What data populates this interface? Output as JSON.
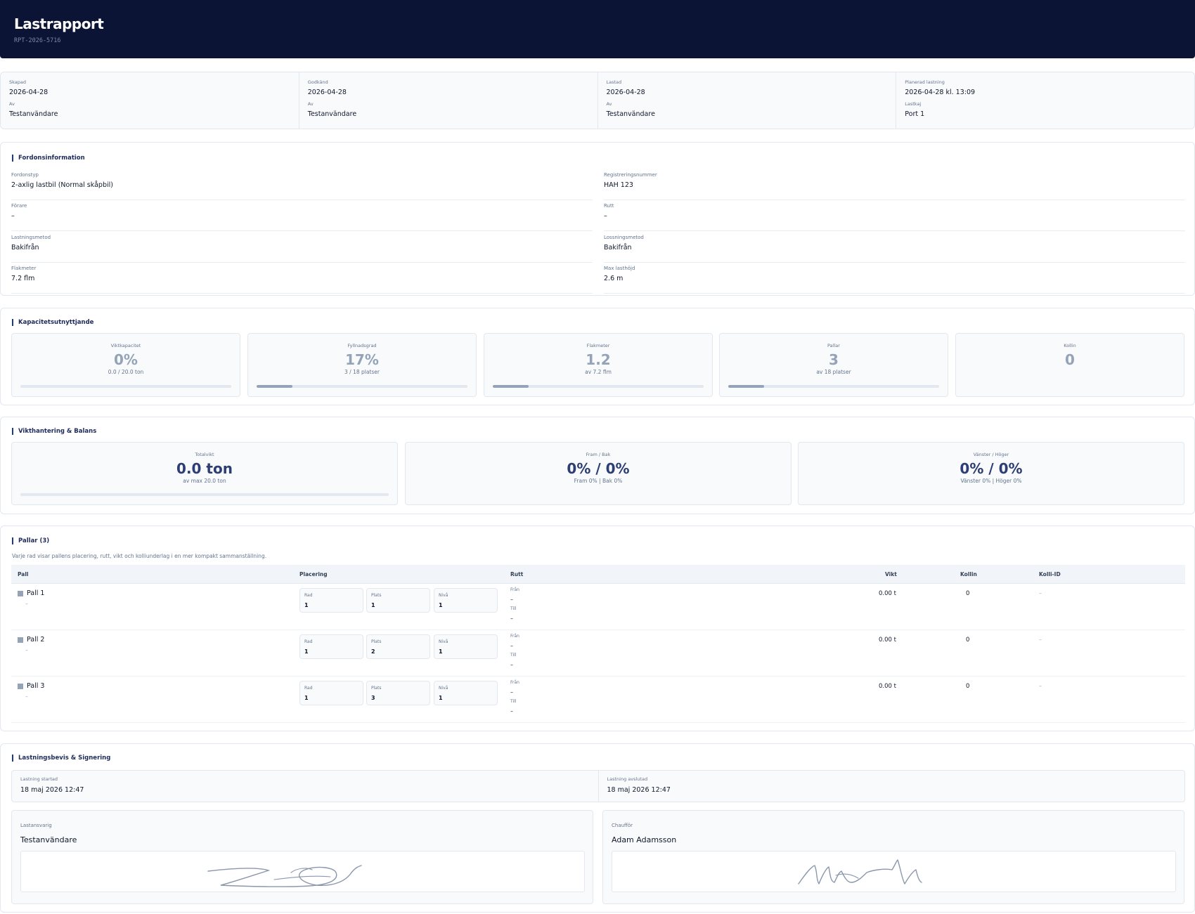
{
  "header": {
    "title": "Lastrapport",
    "report_id": "RPT-2026-5716"
  },
  "meta": [
    {
      "label": "Skapad",
      "value": "2026-04-28",
      "sub_label": "Av",
      "sub_value": "Testanvändare"
    },
    {
      "label": "Godkänd",
      "value": "2026-04-28",
      "sub_label": "Av",
      "sub_value": "Testanvändare"
    },
    {
      "label": "Lastad",
      "value": "2026-04-28",
      "sub_label": "Av",
      "sub_value": "Testanvändare"
    },
    {
      "label": "Planerad lastning",
      "value": "2026-04-28 kl. 13:09",
      "sub_label": "Lastkaj",
      "sub_value": "Port 1"
    }
  ],
  "vehicle": {
    "title": "Fordonsinformation",
    "fields": [
      {
        "label": "Fordonstyp",
        "value": "2-axlig lastbil (Normal skåpbil)"
      },
      {
        "label": "Registreringsnummer",
        "value": "HAH 123"
      },
      {
        "label": "Förare",
        "value": "–"
      },
      {
        "label": "Rutt",
        "value": "–"
      },
      {
        "label": "Lastningsmetod",
        "value": "Bakifrån"
      },
      {
        "label": "Lossningsmetod",
        "value": "Bakifrån"
      },
      {
        "label": "Flakmeter",
        "value": "7.2 flm"
      },
      {
        "label": "Max lasthöjd",
        "value": "2.6 m"
      }
    ]
  },
  "capacity": {
    "title": "Kapacitetsutnyttjande",
    "boxes": [
      {
        "label": "Viktkapacitet",
        "value": "0%",
        "sub": "0.0 / 20.0 ton",
        "fill": 0
      },
      {
        "label": "Fyllnadsgrad",
        "value": "17%",
        "sub": "3 / 18 platser",
        "fill": 0.17
      },
      {
        "label": "Flakmeter",
        "value": "1.2",
        "sub": "av 7.2 flm",
        "fill": 0.17
      },
      {
        "label": "Pallar",
        "value": "3",
        "sub": "av 18 platser",
        "fill": 0.17
      },
      {
        "label": "Kollin",
        "value": "0",
        "sub": ""
      }
    ]
  },
  "weight": {
    "title": "Vikthantering & Balans",
    "boxes": [
      {
        "label": "Totalvikt",
        "value": "0.0 ton",
        "sub": "av max 20.0 ton",
        "fill": 0
      },
      {
        "label": "Fram / Bak",
        "value": "0% / 0%",
        "sub": "Fram 0% | Bak 0%"
      },
      {
        "label": "Vänster / Höger",
        "value": "0% / 0%",
        "sub": "Vänster 0% | Höger 0%"
      }
    ]
  },
  "pallets": {
    "title": "Pallar (3)",
    "description": "Varje rad visar pallens placering, rutt, vikt och kolliunderlag i en mer kompakt sammanställning.",
    "columns": {
      "pall": "Pall",
      "placering": "Placering",
      "rutt": "Rutt",
      "vikt": "Vikt",
      "kollin": "Kollin",
      "kolli_id": "Kolli-ID"
    },
    "rows": [
      {
        "name": "Pall 1",
        "sub": "–",
        "rad_label": "Rad",
        "rad": "1",
        "plats_label": "Plats",
        "plats": "1",
        "niva_label": "Nivå",
        "niva": "1",
        "fran_label": "Från",
        "fran": "–",
        "till_label": "Till",
        "till": "–",
        "vikt": "0.00 t",
        "kollin": "0",
        "kolli_id": "–"
      },
      {
        "name": "Pall 2",
        "sub": "–",
        "rad_label": "Rad",
        "rad": "1",
        "plats_label": "Plats",
        "plats": "2",
        "niva_label": "Nivå",
        "niva": "1",
        "fran_label": "Från",
        "fran": "–",
        "till_label": "Till",
        "till": "–",
        "vikt": "0.00 t",
        "kollin": "0",
        "kolli_id": "–"
      },
      {
        "name": "Pall 3",
        "sub": "–",
        "rad_label": "Rad",
        "rad": "1",
        "plats_label": "Plats",
        "plats": "3",
        "niva_label": "Nivå",
        "niva": "1",
        "fran_label": "Från",
        "fran": "–",
        "till_label": "Till",
        "till": "–",
        "vikt": "0.00 t",
        "kollin": "0",
        "kolli_id": "–"
      }
    ]
  },
  "signing": {
    "title": "Lastningsbevis & Signering",
    "started_label": "Lastning startad",
    "started_value": "18 maj 2026 12:47",
    "ended_label": "Lastning avslutad",
    "ended_value": "18 maj 2026 12:47",
    "signers": [
      {
        "label": "Lastansvarig",
        "name": "Testanvändare"
      },
      {
        "label": "Chaufför",
        "name": "Adam Adamsson"
      }
    ]
  },
  "colors": {
    "header_bg": "#0c1435",
    "accent": "#1e3a8a",
    "value_dark": "#2c3e73",
    "muted": "#94a3b8"
  }
}
